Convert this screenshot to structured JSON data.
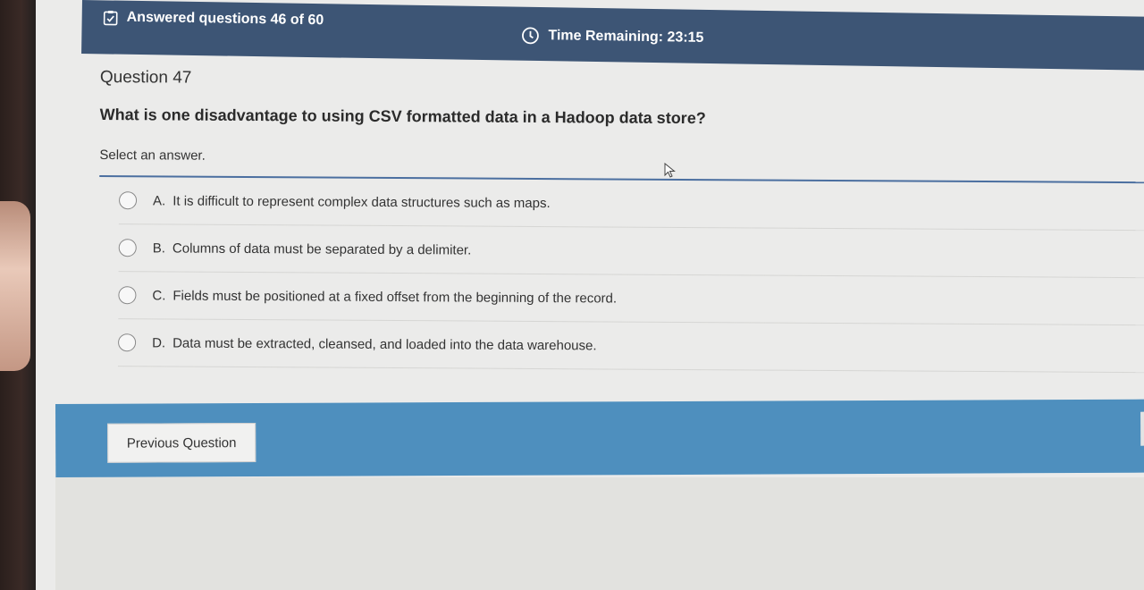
{
  "header": {
    "answered_label": "Answered questions 46 of 60",
    "timer_label": "Time Remaining: 23:15",
    "answered_icon": "clipboard-check-icon",
    "timer_icon": "clock-icon"
  },
  "question": {
    "number_label": "Question 47",
    "text": "What is one disadvantage to using CSV formatted data in a Hadoop data store?",
    "instruction": "Select an answer.",
    "options": [
      {
        "letter": "A.",
        "text": "It is difficult to represent complex data structures such as maps."
      },
      {
        "letter": "B.",
        "text": "Columns of data must be separated by a delimiter."
      },
      {
        "letter": "C.",
        "text": "Fields must be positioned at a fixed offset from the beginning of the record."
      },
      {
        "letter": "D.",
        "text": "Data must be extracted, cleansed, and loaded into the data warehouse."
      }
    ]
  },
  "footer": {
    "previous_label": "Previous Question"
  },
  "colors": {
    "header_bg": "#3d5575",
    "footer_bg": "#4e8fbe",
    "divider": "#4b6fa0"
  }
}
